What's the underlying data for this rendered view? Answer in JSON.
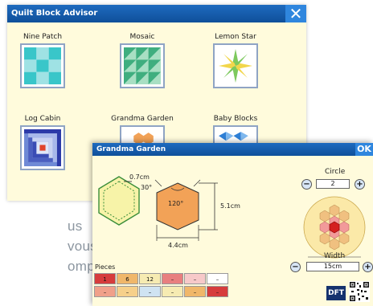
{
  "background_text": [
    "us",
    "vous",
    "ompris"
  ],
  "advisor": {
    "title": "Quilt Block Advisor",
    "blocks": [
      {
        "name": "Nine Patch"
      },
      {
        "name": "Mosaic"
      },
      {
        "name": "Lemon Star"
      },
      {
        "name": "Log Cabin"
      },
      {
        "name": "Grandma Garden"
      },
      {
        "name": "Baby Blocks"
      }
    ]
  },
  "detail": {
    "title": "Grandma Garden",
    "ok_label": "OK",
    "seam": "0.7cm",
    "angle_top": "30°",
    "angle_inner": "120°",
    "height": "5.1cm",
    "width_dim": "4.4cm",
    "circle_label": "Circle",
    "circle_value": "2",
    "width_label": "Width",
    "width_value": "15cm",
    "pieces_label": "Pieces",
    "pieces_row1": [
      "1",
      "6",
      "12",
      "–",
      "–",
      "–"
    ],
    "pieces_row2": [
      "–",
      "–",
      "–",
      "–",
      "–",
      "–"
    ],
    "dft_label": "DFT"
  },
  "colors": {
    "titlebar": "#1560b0",
    "window_bg": "#fffbdc",
    "hexagon": "#f2a257",
    "teal": "#39c6c9",
    "green": "#3fae7f"
  }
}
